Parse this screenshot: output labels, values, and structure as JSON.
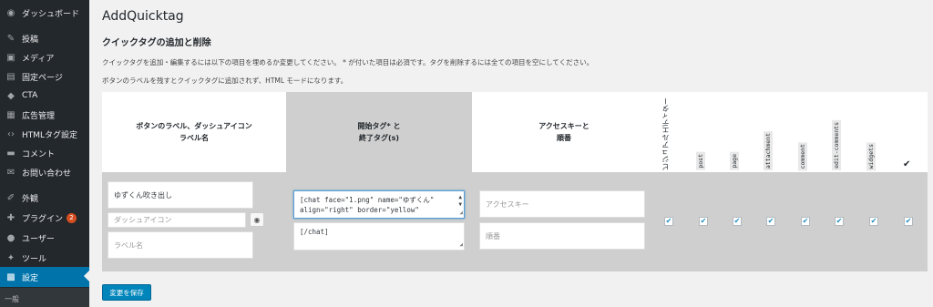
{
  "sidebar": {
    "items": [
      {
        "label": "ダッシュボード",
        "icon": "dashboard-icon",
        "glyph": "◉"
      },
      {
        "label": "投稿",
        "icon": "pin-icon",
        "glyph": "✎"
      },
      {
        "label": "メディア",
        "icon": "media-icon",
        "glyph": "▣"
      },
      {
        "label": "固定ページ",
        "icon": "page-icon",
        "glyph": "▤"
      },
      {
        "label": "CTA",
        "icon": "tag-icon",
        "glyph": "◆"
      },
      {
        "label": "広告管理",
        "icon": "ad-icon",
        "glyph": "▦"
      },
      {
        "label": "HTMLタグ設定",
        "icon": "code-icon",
        "glyph": "‹›"
      },
      {
        "label": "コメント",
        "icon": "comment-icon",
        "glyph": "▬"
      },
      {
        "label": "お問い合わせ",
        "icon": "mail-icon",
        "glyph": "✉"
      },
      {
        "label": "外観",
        "icon": "appearance-icon",
        "glyph": "✐"
      },
      {
        "label": "プラグイン",
        "icon": "plugin-icon",
        "glyph": "✚",
        "badge": "2"
      },
      {
        "label": "ユーザー",
        "icon": "user-icon",
        "glyph": "●"
      },
      {
        "label": "ツール",
        "icon": "tool-icon",
        "glyph": "✦"
      },
      {
        "label": "設定",
        "icon": "settings-icon",
        "glyph": "▩"
      }
    ],
    "sub_item": "一般"
  },
  "page": {
    "title": "AddQuicktag",
    "section_title": "クイックタグの追加と削除",
    "desc1": "クイックタグを追加・編集するには以下の項目を埋めるか変更してください。 * が付いた項目は必須です。タグを削除するには全ての項目を空にしてください。",
    "desc2": "ボタンのラベルを残すとクイックタグに追加されず、HTML モードになります。"
  },
  "table": {
    "col_label_line1": "ボタンのラベル、ダッシュアイコン",
    "col_label_line2": "ラベル名",
    "col_tag_line1": "開始タグ* と",
    "col_tag_line2": "終了タグ(s)",
    "col_access_line1": "アクセスキーと",
    "col_access_line2": "順番",
    "col_visual": "ビジュアルエディター",
    "col_codes": [
      "post",
      "page",
      "attachment",
      "comment",
      "edit-comments",
      "widgets"
    ],
    "col_all_glyph": "✔"
  },
  "row": {
    "button_label_value": "ゆずくん吹き出し",
    "dashicon_placeholder": "ダッシュアイコン",
    "label_name_placeholder": "ラベル名",
    "start_tag_line1": "[chat face=\"1.png\" name=\"ゆずくん\"",
    "start_tag_line2": "align=\"right\" border=\"yellow\"",
    "end_tag_value": "[/chat]",
    "access_key_placeholder": "アクセスキー",
    "order_placeholder": "順番",
    "check_glyph": "✔"
  },
  "save_button": "変更を保存"
}
